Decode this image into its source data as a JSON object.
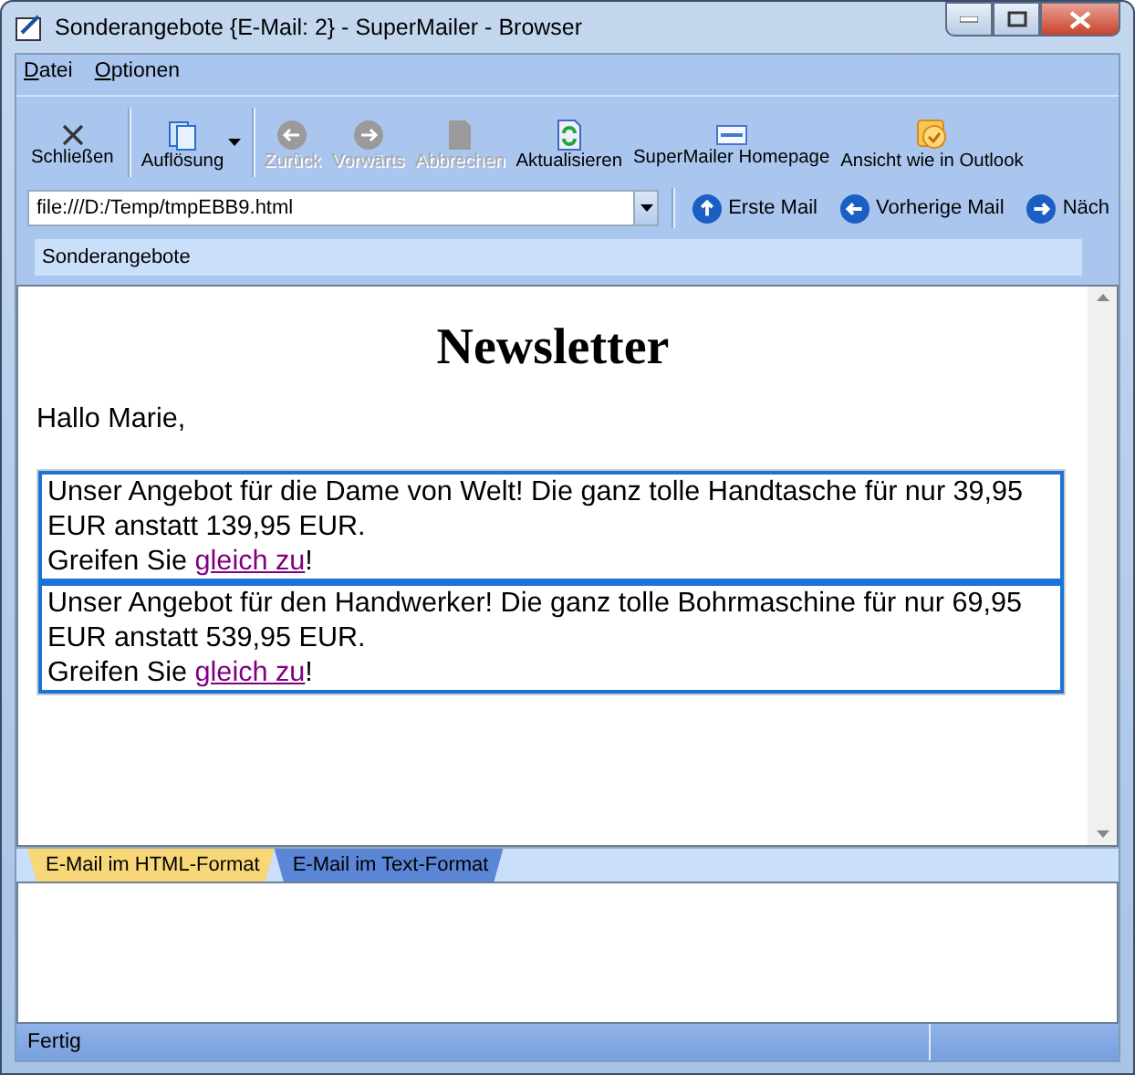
{
  "window": {
    "title": "Sonderangebote {E-Mail: 2} - SuperMailer - Browser"
  },
  "menu": [
    "Datei",
    "Optionen"
  ],
  "toolbar": [
    {
      "kind": "close",
      "label": "Schließen",
      "disabled": false
    },
    {
      "kind": "resolution",
      "label": "Auflösung",
      "disabled": false,
      "dropdown": true
    },
    {
      "kind": "back",
      "label": "Zurück",
      "disabled": true
    },
    {
      "kind": "forward",
      "label": "Vorwärts",
      "disabled": true
    },
    {
      "kind": "stop",
      "label": "Abbrechen",
      "disabled": true
    },
    {
      "kind": "refresh",
      "label": "Aktualisieren",
      "disabled": false
    },
    {
      "kind": "home",
      "label": "SuperMailer Homepage",
      "disabled": false
    },
    {
      "kind": "outlook",
      "label": "Ansicht wie in Outlook",
      "disabled": false
    }
  ],
  "address": {
    "value": "file:///D:/Temp/tmpEBB9.html"
  },
  "nav": [
    {
      "kind": "up",
      "label": "Erste Mail"
    },
    {
      "kind": "left",
      "label": "Vorherige Mail"
    },
    {
      "kind": "right",
      "label": "Näch"
    }
  ],
  "bookmarks": [
    "Sonderangebote"
  ],
  "email": {
    "heading": "Newsletter",
    "greeting": "Hallo Marie,",
    "offers": [
      {
        "text": "Unser Angebot für die Dame von Welt! Die ganz tolle Handtasche für nur 39,95 EUR anstatt 139,95 EUR.",
        "cta_before": "Greifen Sie",
        "link": "gleich zu",
        "cta_after": "!"
      },
      {
        "text": "Unser Angebot für den Handwerker! Die ganz tolle Bohrmaschine für nur 69,95 EUR anstatt 539,95 EUR.",
        "cta_before": "Greifen Sie",
        "link": "gleich zu",
        "cta_after": "!"
      }
    ]
  },
  "tabs": [
    {
      "label": "E-Mail im HTML-Format",
      "selected": true
    },
    {
      "label": "E-Mail im Text-Format",
      "selected": false
    }
  ],
  "status_bar": {
    "text": "Fertig"
  }
}
